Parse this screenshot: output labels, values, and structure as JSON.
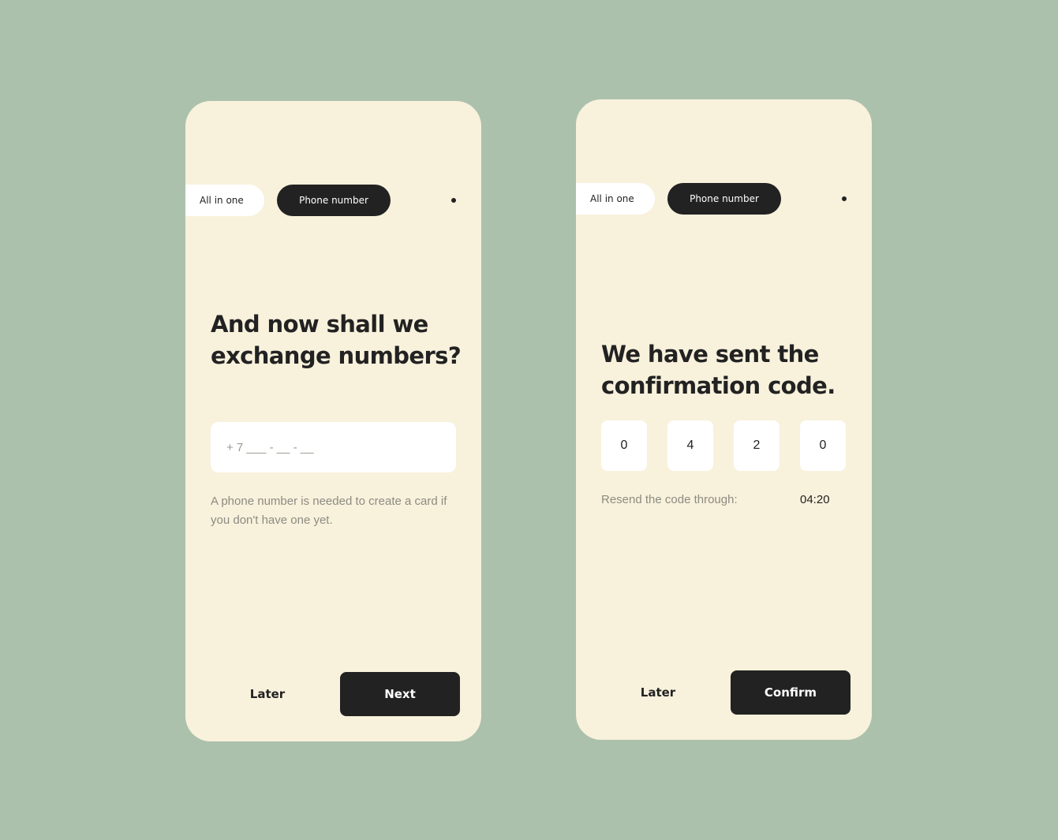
{
  "screens": [
    {
      "tabs": {
        "all_in_one": "All in one",
        "phone_number": "Phone number"
      },
      "heading": "And now shall we exchange numbers?",
      "phone_input": {
        "placeholder": "+ 7 ___ - __ - __",
        "value": ""
      },
      "hint": "A phone number is needed to create a card if you don't have one yet.",
      "later_label": "Later",
      "primary_label": "Next"
    },
    {
      "tabs": {
        "all_in_one": "All in one",
        "phone_number": "Phone number"
      },
      "heading": "We have sent the confirmation code.",
      "code_digits": [
        "0",
        "4",
        "2",
        "0"
      ],
      "resend_label": "Resend the code through:",
      "timer": "04:20",
      "later_label": "Later",
      "primary_label": "Confirm"
    }
  ],
  "colors": {
    "background": "#abc1ab",
    "card": "#f8f1dc",
    "dark": "#222222",
    "white": "#ffffff",
    "muted_text": "#8c8c82"
  }
}
